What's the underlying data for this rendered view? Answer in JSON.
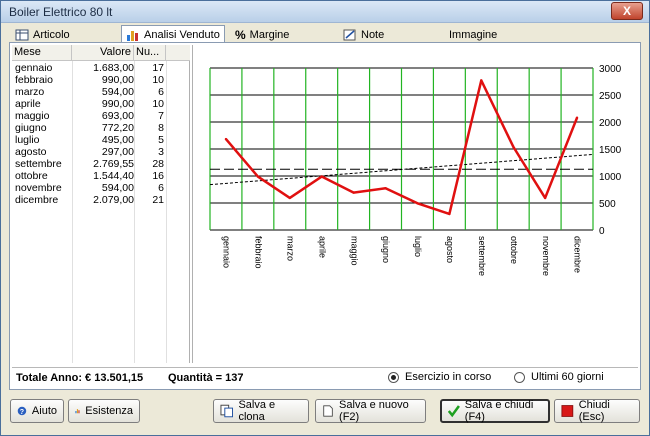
{
  "window": {
    "title": "Boiler Elettrico 80 lt",
    "close_label": "X"
  },
  "tabs": [
    {
      "label": "Articolo",
      "icon": "table-icon"
    },
    {
      "label": "Analisi Venduto",
      "icon": "bar-chart-icon"
    },
    {
      "label": "Margine",
      "icon": "percent-icon"
    },
    {
      "label": "Note",
      "icon": "note-icon"
    },
    {
      "label": "Immagine",
      "icon": ""
    }
  ],
  "list": {
    "headers": [
      "Mese",
      "Valore",
      "Nu..."
    ],
    "rows": [
      {
        "mese": "gennaio",
        "valore": "1.683,00",
        "num": "17"
      },
      {
        "mese": "febbraio",
        "valore": "990,00",
        "num": "10"
      },
      {
        "mese": "marzo",
        "valore": "594,00",
        "num": "6"
      },
      {
        "mese": "aprile",
        "valore": "990,00",
        "num": "10"
      },
      {
        "mese": "maggio",
        "valore": "693,00",
        "num": "7"
      },
      {
        "mese": "giugno",
        "valore": "772,20",
        "num": "8"
      },
      {
        "mese": "luglio",
        "valore": "495,00",
        "num": "5"
      },
      {
        "mese": "agosto",
        "valore": "297,00",
        "num": "3"
      },
      {
        "mese": "settembre",
        "valore": "2.769,55",
        "num": "28"
      },
      {
        "mese": "ottobre",
        "valore": "1.544,40",
        "num": "16"
      },
      {
        "mese": "novembre",
        "valore": "594,00",
        "num": "6"
      },
      {
        "mese": "dicembre",
        "valore": "2.079,00",
        "num": "21"
      }
    ]
  },
  "status": {
    "totale": "Totale Anno: € 13.501,15",
    "quantita": "Quantità = 137",
    "radio_current": "Esercizio in corso",
    "radio_60": "Ultimi 60 giorni",
    "radio_current_selected": true
  },
  "buttons": {
    "aiuto": "Aiuto",
    "esistenza": "Esistenza",
    "salva_clona": "Salva e clona",
    "salva_nuovo": "Salva e nuovo (F2)",
    "salva_chiudi": "Salva e chiudi (F4)",
    "chiudi": "Chiudi (Esc)"
  },
  "colors": {
    "series": "#e01010",
    "grid_vertical": "#22b422",
    "grid_horizontal": "#000000"
  },
  "chart_data": {
    "type": "line",
    "categories": [
      "gennaio",
      "febbraio",
      "marzo",
      "aprile",
      "maggio",
      "giugno",
      "luglio",
      "agosto",
      "settembre",
      "ottobre",
      "novembre",
      "dicembre"
    ],
    "series": [
      {
        "values": [
          1683,
          990,
          594,
          990,
          693,
          772.2,
          495,
          297,
          2769.55,
          1544.4,
          594,
          2079
        ]
      }
    ],
    "average": 1125,
    "trend": [
      840,
      1400
    ],
    "ylim": [
      0,
      3000
    ],
    "yticks": [
      "0",
      "500",
      "1000",
      "1500",
      "2000",
      "2500",
      "3000"
    ],
    "grid": true
  }
}
